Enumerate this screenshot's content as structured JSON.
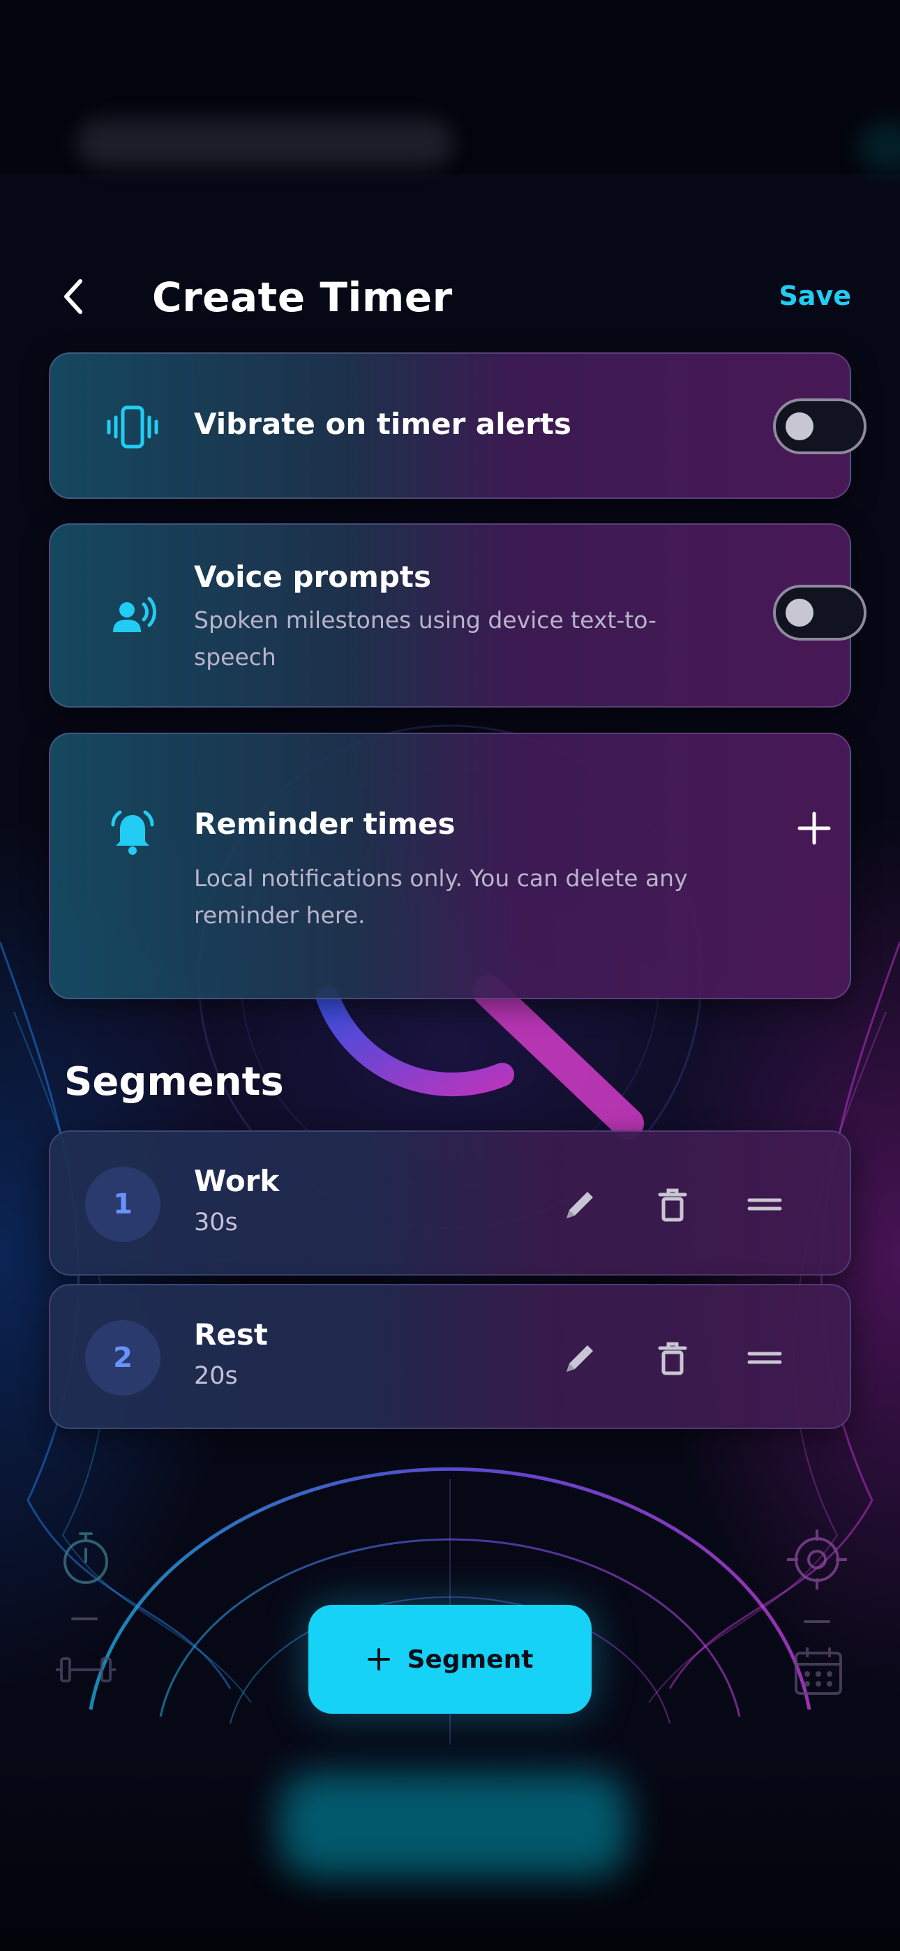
{
  "header": {
    "back_icon": "chevron-left-icon",
    "title": "Create Timer",
    "save_label": "Save"
  },
  "settings": {
    "vibrate": {
      "icon": "phone-vibrate-icon",
      "title": "Vibrate on timer alerts",
      "enabled": false
    },
    "voice": {
      "icon": "voice-speaker-icon",
      "title": "Voice prompts",
      "subtitle": "Spoken milestones using device text-to-speech",
      "enabled": false
    },
    "reminders": {
      "icon": "bell-ring-icon",
      "title": "Reminder times",
      "subtitle": "Local notifications only. You can delete any reminder here.",
      "add_icon": "plus-icon"
    }
  },
  "segments": {
    "title": "Segments",
    "items": [
      {
        "number": "1",
        "name": "Work",
        "duration": "30s"
      },
      {
        "number": "2",
        "name": "Rest",
        "duration": "20s"
      }
    ],
    "action_icons": [
      "pencil-icon",
      "trash-icon",
      "drag-handle-icon"
    ]
  },
  "add_segment": {
    "icon": "plus-icon",
    "label": "Segment"
  },
  "colors": {
    "accent": "#22ccf2",
    "button": "#16d2f6",
    "number_badge": "#2a3a6c",
    "number_text": "#6a92ff"
  }
}
